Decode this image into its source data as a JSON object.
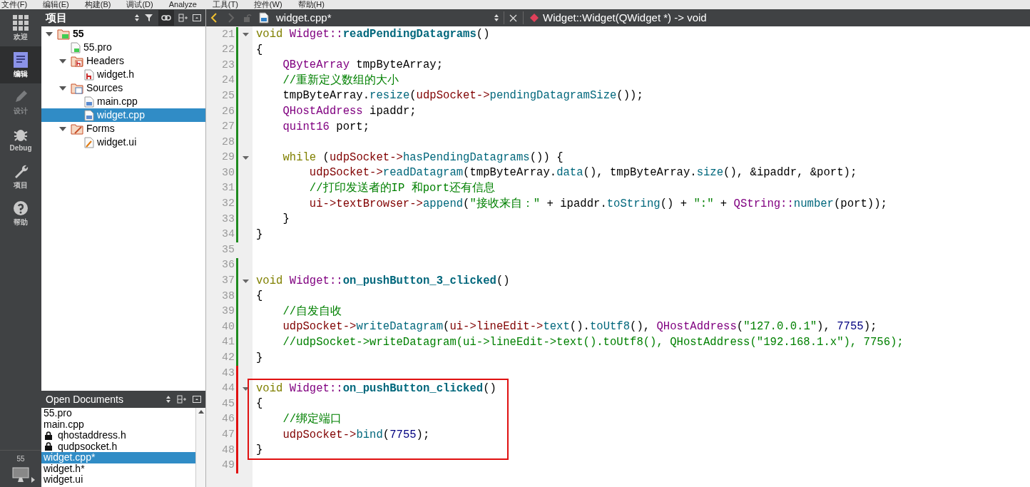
{
  "menu_bar": [
    "文件(F)",
    "编辑(E)",
    "构建(B)",
    "调试(D)",
    "Analyze",
    "工具(T)",
    "控件(W)",
    "帮助(H)"
  ],
  "mode_bar": {
    "items": [
      {
        "kind": "welcome",
        "label": "欢迎",
        "selected": false,
        "disabled": false
      },
      {
        "kind": "edit",
        "label": "编辑",
        "selected": true,
        "disabled": false
      },
      {
        "kind": "design",
        "label": "设计",
        "selected": false,
        "disabled": true
      },
      {
        "kind": "debug",
        "label": "Debug",
        "selected": false,
        "disabled": false
      },
      {
        "kind": "projects",
        "label": "项目",
        "selected": false,
        "disabled": false
      },
      {
        "kind": "help",
        "label": "帮助",
        "selected": false,
        "disabled": false
      }
    ],
    "target": "55"
  },
  "project_panel": {
    "title": "项目",
    "tree": [
      {
        "label": "55",
        "kind": "project",
        "expanded": true,
        "selected": false,
        "children": [
          {
            "label": "55.pro",
            "kind": "pro",
            "selected": false
          },
          {
            "label": "Headers",
            "kind": "folder-h",
            "expanded": true,
            "selected": false,
            "children": [
              {
                "label": "widget.h",
                "kind": "header",
                "selected": false
              }
            ]
          },
          {
            "label": "Sources",
            "kind": "folder-cpp",
            "expanded": true,
            "selected": false,
            "children": [
              {
                "label": "main.cpp",
                "kind": "cpp",
                "selected": false
              },
              {
                "label": "widget.cpp",
                "kind": "cpp",
                "selected": true
              }
            ]
          },
          {
            "label": "Forms",
            "kind": "folder-ui",
            "expanded": true,
            "selected": false,
            "children": [
              {
                "label": "widget.ui",
                "kind": "ui",
                "selected": false
              }
            ]
          }
        ]
      }
    ]
  },
  "open_documents": {
    "title": "Open Documents",
    "items": [
      {
        "label": "55.pro",
        "locked": false,
        "selected": false
      },
      {
        "label": "main.cpp",
        "locked": false,
        "selected": false
      },
      {
        "label": "qhostaddress.h",
        "locked": true,
        "selected": false
      },
      {
        "label": "qudpsocket.h",
        "locked": true,
        "selected": false
      },
      {
        "label": "widget.cpp*",
        "locked": false,
        "selected": true
      },
      {
        "label": "widget.h*",
        "locked": false,
        "selected": false
      },
      {
        "label": "widget.ui",
        "locked": false,
        "selected": false
      }
    ]
  },
  "editor": {
    "file": "widget.cpp*",
    "symbol": "Widget::Widget(QWidget *) -> void",
    "lines": [
      {
        "number": "21",
        "color": "#1e8a1e",
        "fold": true,
        "tokens": [
          {
            "kind": "keyword",
            "text": "void"
          },
          {
            "kind": "type",
            "text": " Widget::"
          },
          {
            "kind": "def",
            "text": "readPendingDatagrams"
          },
          {
            "kind": "plain",
            "text": "()"
          }
        ]
      },
      {
        "number": "22",
        "color": "#1e8a1e",
        "fold": false,
        "tokens": [
          {
            "kind": "plain",
            "text": "{"
          }
        ]
      },
      {
        "number": "23",
        "color": "#1e8a1e",
        "fold": false,
        "tokens": [
          {
            "kind": "type",
            "text": "    QByteArray"
          },
          {
            "kind": "plain",
            "text": " tmpByteArray;"
          }
        ]
      },
      {
        "number": "24",
        "color": "#1e8a1e",
        "fold": false,
        "tokens": [
          {
            "kind": "comment",
            "text": "    //重新定义数组的大小"
          }
        ]
      },
      {
        "number": "25",
        "color": "#1e8a1e",
        "fold": false,
        "tokens": [
          {
            "kind": "plain",
            "text": "    tmpByteArray."
          },
          {
            "kind": "func",
            "text": "resize"
          },
          {
            "kind": "plain",
            "text": "("
          },
          {
            "kind": "var",
            "text": "udpSocket->"
          },
          {
            "kind": "func",
            "text": "pendingDatagramSize"
          },
          {
            "kind": "plain",
            "text": "());"
          }
        ]
      },
      {
        "number": "26",
        "color": "#1e8a1e",
        "fold": false,
        "tokens": [
          {
            "kind": "type",
            "text": "    QHostAddress"
          },
          {
            "kind": "plain",
            "text": " ipaddr;"
          }
        ]
      },
      {
        "number": "27",
        "color": "#1e8a1e",
        "fold": false,
        "tokens": [
          {
            "kind": "type",
            "text": "    quint16"
          },
          {
            "kind": "plain",
            "text": " port;"
          }
        ]
      },
      {
        "number": "28",
        "color": "#1e8a1e",
        "fold": false
      },
      {
        "number": "29",
        "color": "#1e8a1e",
        "fold": true,
        "tokens": [
          {
            "kind": "keyword",
            "text": "    while"
          },
          {
            "kind": "plain",
            "text": " ("
          },
          {
            "kind": "var",
            "text": "udpSocket->"
          },
          {
            "kind": "func",
            "text": "hasPendingDatagrams"
          },
          {
            "kind": "plain",
            "text": "()) {"
          }
        ]
      },
      {
        "number": "30",
        "color": "#1e8a1e",
        "fold": false,
        "tokens": [
          {
            "kind": "var",
            "text": "        udpSocket->"
          },
          {
            "kind": "func",
            "text": "readDatagram"
          },
          {
            "kind": "plain",
            "text": "(tmpByteArray."
          },
          {
            "kind": "func",
            "text": "data"
          },
          {
            "kind": "plain",
            "text": "(), tmpByteArray."
          },
          {
            "kind": "func",
            "text": "size"
          },
          {
            "kind": "plain",
            "text": "(), &ipaddr, &port);"
          }
        ]
      },
      {
        "number": "31",
        "color": "#1e8a1e",
        "fold": false,
        "tokens": [
          {
            "kind": "comment",
            "text": "        //打印发送者的IP 和port还有信息"
          }
        ]
      },
      {
        "number": "32",
        "color": "#1e8a1e",
        "fold": false,
        "tokens": [
          {
            "kind": "var",
            "text": "        ui->textBrowser->"
          },
          {
            "kind": "func",
            "text": "append"
          },
          {
            "kind": "plain",
            "text": "("
          },
          {
            "kind": "string",
            "text": "\"接收来自：\""
          },
          {
            "kind": "plain",
            "text": " + ipaddr."
          },
          {
            "kind": "func",
            "text": "toString"
          },
          {
            "kind": "plain",
            "text": "() + "
          },
          {
            "kind": "string",
            "text": "\":\""
          },
          {
            "kind": "plain",
            "text": " + "
          },
          {
            "kind": "type",
            "text": "QString::"
          },
          {
            "kind": "func",
            "text": "number"
          },
          {
            "kind": "plain",
            "text": "(port));"
          }
        ]
      },
      {
        "number": "33",
        "color": "#1e8a1e",
        "fold": false,
        "tokens": [
          {
            "kind": "plain",
            "text": "    }"
          }
        ]
      },
      {
        "number": "34",
        "color": "#1e8a1e",
        "fold": false,
        "tokens": [
          {
            "kind": "plain",
            "text": "}"
          }
        ]
      },
      {
        "number": "35",
        "fold": false
      },
      {
        "number": "36",
        "color": "#1e8a1e",
        "fold": false
      },
      {
        "number": "37",
        "color": "#1e8a1e",
        "fold": true,
        "tokens": [
          {
            "kind": "keyword",
            "text": "void"
          },
          {
            "kind": "type",
            "text": " Widget::"
          },
          {
            "kind": "def",
            "text": "on_pushButton_3_clicked"
          },
          {
            "kind": "plain",
            "text": "()"
          }
        ]
      },
      {
        "number": "38",
        "color": "#1e8a1e",
        "fold": false,
        "tokens": [
          {
            "kind": "plain",
            "text": "{"
          }
        ]
      },
      {
        "number": "39",
        "color": "#1e8a1e",
        "fold": false,
        "tokens": [
          {
            "kind": "comment",
            "text": "    //自发自收"
          }
        ]
      },
      {
        "number": "40",
        "color": "#1e8a1e",
        "fold": false,
        "tokens": [
          {
            "kind": "var",
            "text": "    udpSocket->"
          },
          {
            "kind": "func",
            "text": "writeDatagram"
          },
          {
            "kind": "plain",
            "text": "("
          },
          {
            "kind": "var",
            "text": "ui->lineEdit->"
          },
          {
            "kind": "func",
            "text": "text"
          },
          {
            "kind": "plain",
            "text": "()."
          },
          {
            "kind": "func",
            "text": "toUtf8"
          },
          {
            "kind": "plain",
            "text": "(), "
          },
          {
            "kind": "type",
            "text": "QHostAddress"
          },
          {
            "kind": "plain",
            "text": "("
          },
          {
            "kind": "string",
            "text": "\"127.0.0.1\""
          },
          {
            "kind": "plain",
            "text": "), "
          },
          {
            "kind": "number",
            "text": "7755"
          },
          {
            "kind": "plain",
            "text": ");"
          }
        ]
      },
      {
        "number": "41",
        "color": "#1e8a1e",
        "fold": false,
        "tokens": [
          {
            "kind": "comment",
            "text": "    //udpSocket->writeDatagram(ui->lineEdit->text().toUtf8(), QHostAddress(\"192.168.1.x\"), 7756);"
          }
        ]
      },
      {
        "number": "42",
        "color": "#1e8a1e",
        "fold": false,
        "tokens": [
          {
            "kind": "plain",
            "text": "}"
          }
        ]
      },
      {
        "number": "43",
        "color": "#e01010",
        "fold": false
      },
      {
        "number": "44",
        "color": "#e01010",
        "fold": true,
        "tokens": [
          {
            "kind": "keyword",
            "text": "void"
          },
          {
            "kind": "type",
            "text": " Widget::"
          },
          {
            "kind": "def",
            "text": "on_pushButton_clicked"
          },
          {
            "kind": "plain",
            "text": "()"
          }
        ]
      },
      {
        "number": "45",
        "color": "#e01010",
        "fold": false,
        "tokens": [
          {
            "kind": "plain",
            "text": "{"
          }
        ]
      },
      {
        "number": "46",
        "color": "#e01010",
        "fold": false,
        "tokens": [
          {
            "kind": "comment",
            "text": "    //绑定端口"
          }
        ]
      },
      {
        "number": "47",
        "color": "#e01010",
        "fold": false,
        "tokens": [
          {
            "kind": "var",
            "text": "    udpSocket->"
          },
          {
            "kind": "func",
            "text": "bind"
          },
          {
            "kind": "plain",
            "text": "("
          },
          {
            "kind": "number",
            "text": "7755"
          },
          {
            "kind": "plain",
            "text": ");"
          }
        ]
      },
      {
        "number": "48",
        "color": "#e01010",
        "fold": false,
        "tokens": [
          {
            "kind": "plain",
            "text": "}"
          }
        ]
      },
      {
        "number": "49",
        "color": "#e01010",
        "fold": false
      }
    ]
  }
}
